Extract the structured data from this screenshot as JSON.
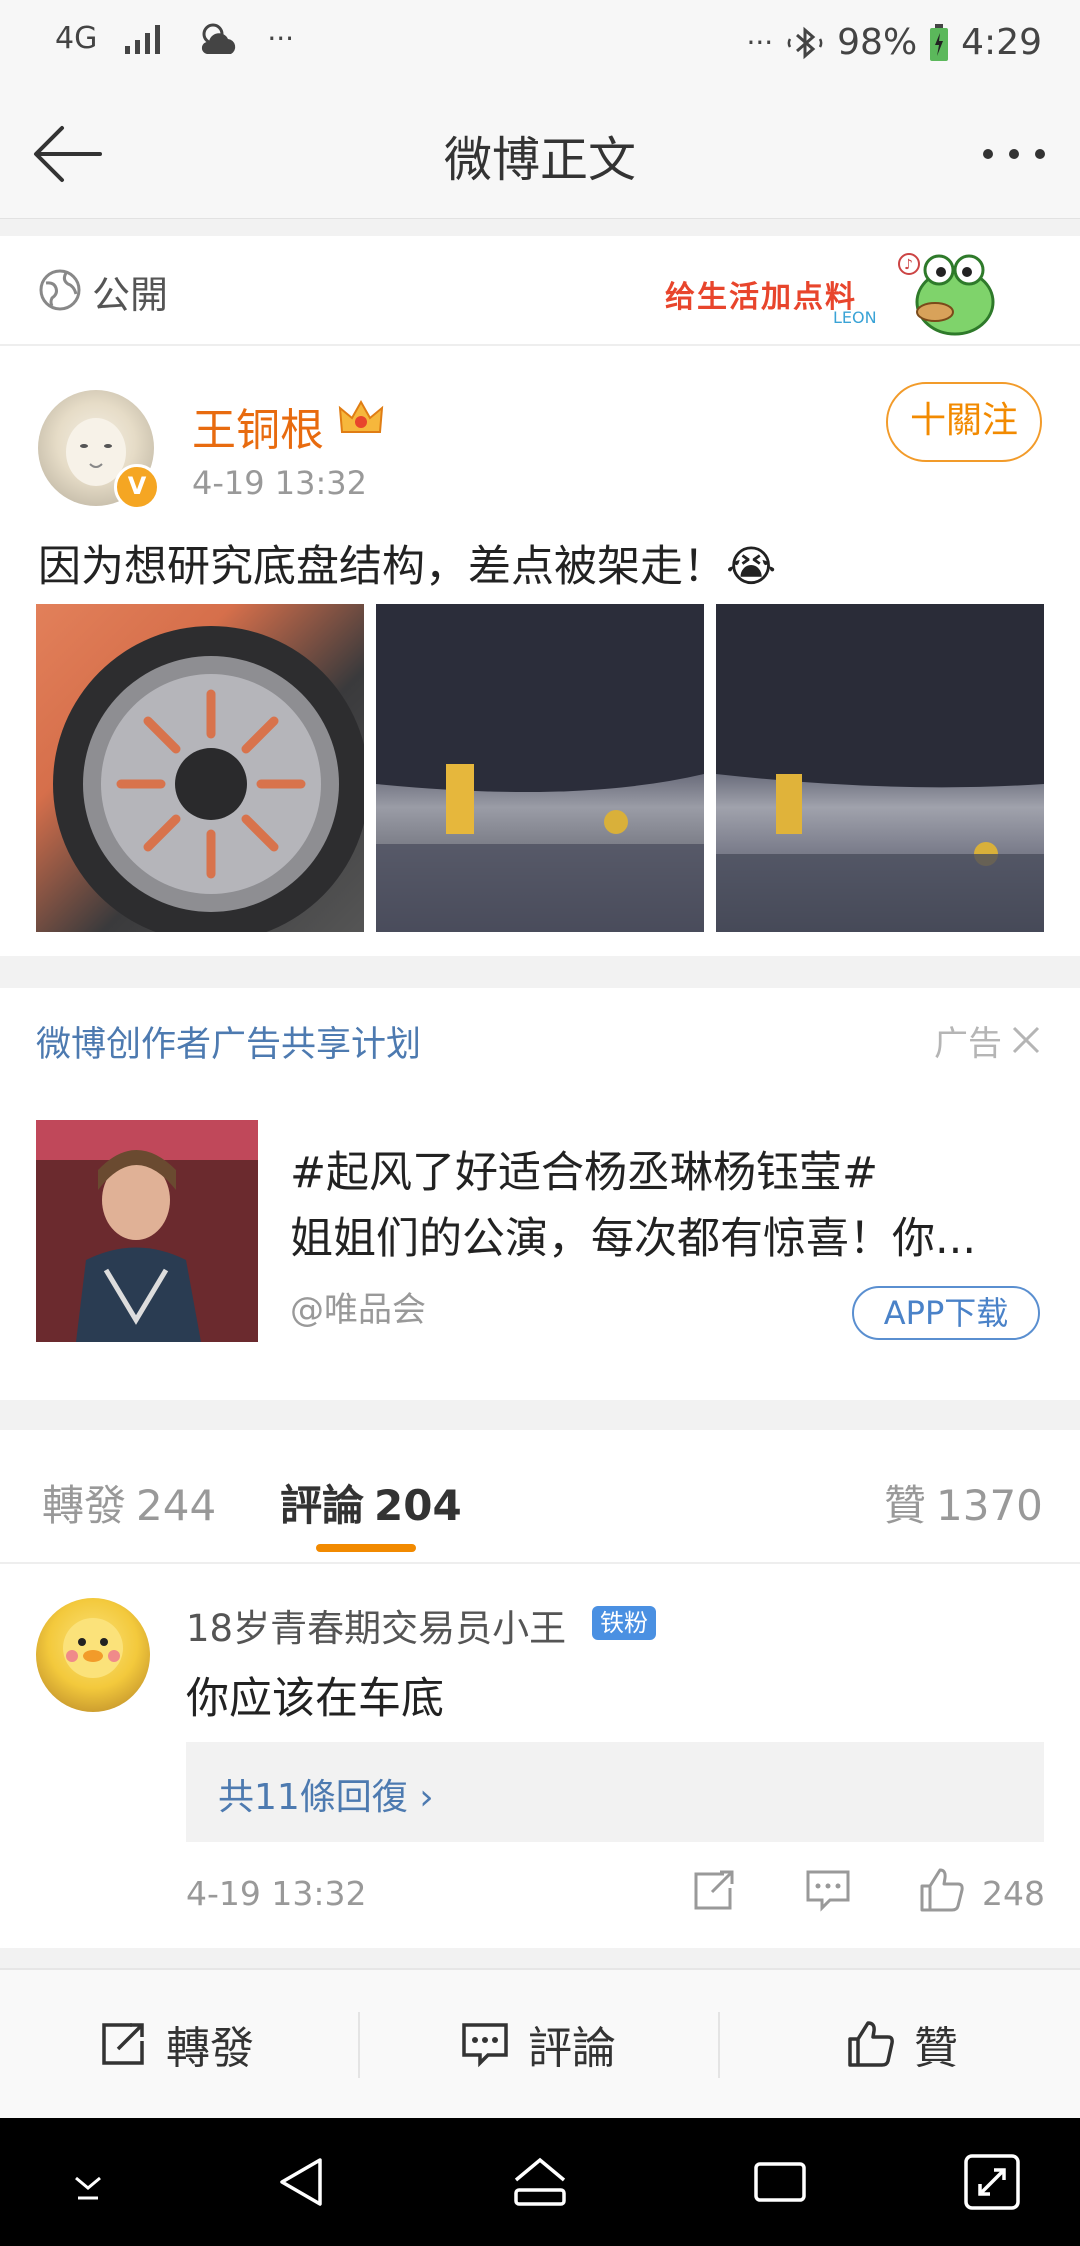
{
  "status_bar": {
    "network": "4G",
    "overflow": "···",
    "dots_right": "···",
    "battery": "98%",
    "time": "4:29"
  },
  "header": {
    "title": "微博正文"
  },
  "visibility": {
    "label": "公開",
    "sticker_text": "给生活加点料",
    "sticker_brand": "LEON"
  },
  "post": {
    "author": "王铜根",
    "time": "4-19 13:32",
    "follow_label": "十關注",
    "text": "因为想研究底盘结构，差点被架走！😭",
    "image_count": 3
  },
  "ad": {
    "title": "微博创作者广告共享计划",
    "tag": "广告",
    "headline": "#起风了好适合杨丞琳杨钰莹#",
    "body": "姐姐们的公演，每次都有惊喜！你...",
    "source": "@唯品会",
    "button": "APP下载"
  },
  "tabs": [
    {
      "label": "轉發",
      "count": "244"
    },
    {
      "label": "評論",
      "count": "204"
    },
    {
      "label": "贊",
      "count": "1370"
    }
  ],
  "comment": {
    "user": "18岁青春期交易员小王",
    "badge": "铁粉",
    "text": "你应该在车底",
    "replies": "共11條回復 ›",
    "time": "4-19 13:32",
    "likes": "248"
  },
  "actions": {
    "repost": "轉發",
    "comment": "評論",
    "like": "贊"
  },
  "colors": {
    "accent_orange": "#f28a00",
    "link_blue": "#4d7ab0",
    "username_orange": "#e86b0f"
  }
}
